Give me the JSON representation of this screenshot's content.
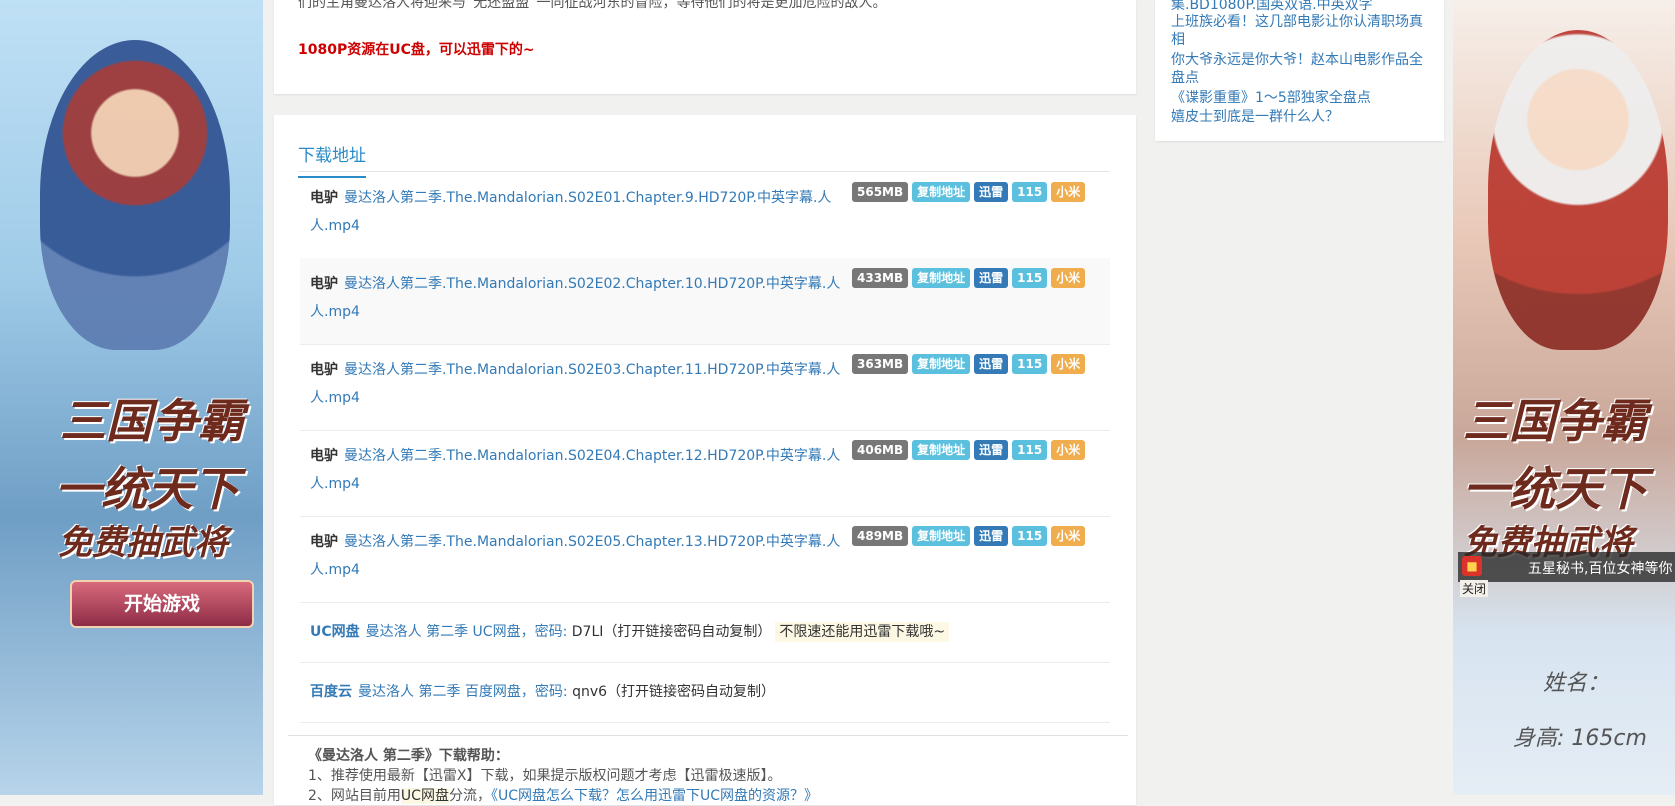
{
  "left_banner": {
    "promo_line1": "三国争霸",
    "promo_line2": "一统天下",
    "promo_line3": "免费抽武将",
    "start_button": "开始游戏"
  },
  "right_banner": {
    "promo_line1": "三国争霸",
    "promo_line2": "一统天下",
    "promo_line3": "免费抽武将",
    "popup_close": "关闭",
    "popup_text": "五星秘书,百位女神等你",
    "card_text_1": "姓名：",
    "card_text_2": "身高: 165cm"
  },
  "top_card": {
    "cut_text": "们的主角曼达洛人将迎来与“无还盟盟”一同征战河东的冒险，等待他们的将是更加危险的敌人。",
    "red_note": "1080P资源在UC盘，可以迅雷下的~"
  },
  "download": {
    "section_title": "下载地址",
    "items": [
      {
        "source": "电驴",
        "name": "曼达洛人第二季.The.Mandalorian.S02E01.Chapter.9.HD720P.中英字幕.人人.mp4",
        "size": "565MB",
        "copy": "复制地址",
        "xunlei": "迅雷",
        "b115": "115",
        "xiaomi": "小米"
      },
      {
        "source": "电驴",
        "name": "曼达洛人第二季.The.Mandalorian.S02E02.Chapter.10.HD720P.中英字幕.人人.mp4",
        "size": "433MB",
        "copy": "复制地址",
        "xunlei": "迅雷",
        "b115": "115",
        "xiaomi": "小米"
      },
      {
        "source": "电驴",
        "name": "曼达洛人第二季.The.Mandalorian.S02E03.Chapter.11.HD720P.中英字幕.人人.mp4",
        "size": "363MB",
        "copy": "复制地址",
        "xunlei": "迅雷",
        "b115": "115",
        "xiaomi": "小米"
      },
      {
        "source": "电驴",
        "name": "曼达洛人第二季.The.Mandalorian.S02E04.Chapter.12.HD720P.中英字幕.人人.mp4",
        "size": "406MB",
        "copy": "复制地址",
        "xunlei": "迅雷",
        "b115": "115",
        "xiaomi": "小米"
      },
      {
        "source": "电驴",
        "name": "曼达洛人第二季.The.Mandalorian.S02E05.Chapter.13.HD720P.中英字幕.人人.mp4",
        "size": "489MB",
        "copy": "复制地址",
        "xunlei": "迅雷",
        "b115": "115",
        "xiaomi": "小米"
      }
    ],
    "uc": {
      "source": "UC网盘",
      "link": "曼达洛人 第二季 UC网盘，密码:",
      "code": "D7LI（打开链接密码自动复制）",
      "note": "不限速还能用迅雷下载哦~"
    },
    "baidu": {
      "source": "百度云",
      "link": "曼达洛人 第二季 百度网盘，密码:",
      "code": "qnv6（打开链接密码自动复制）"
    }
  },
  "help": {
    "title": "《曼达洛人 第二季》下载帮助：",
    "item1": "1、推荐使用最新【迅雷X】下载，如果提示版权问题才考虑【迅雷极速版】。",
    "item2_prefix": "2、网站目前用",
    "item2_uc": "UC网盘",
    "item2_mid": "分流，",
    "item2_link": "《UC网盘怎么下载？怎么用迅雷下UC网盘的资源？》"
  },
  "sidebar": {
    "links": [
      "集.BD1080P.国英双语.中英双字",
      "上班族必看！这几部电影让你认清职场真相",
      "你大爷永远是你大爷！赵本山电影作品全盘点",
      "《谍影重重》1～5部独家全盘点",
      "嬉皮士到底是一群什么人？"
    ]
  }
}
